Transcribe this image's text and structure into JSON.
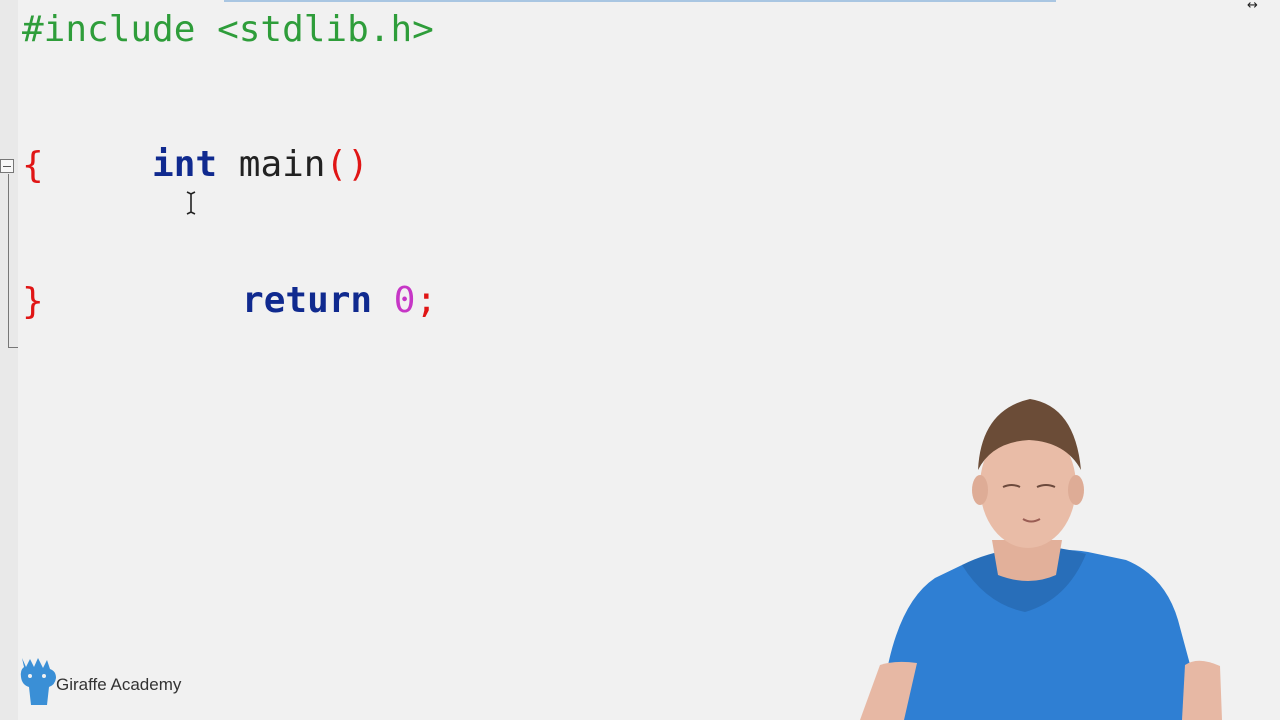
{
  "editor": {
    "lines": {
      "line1": "#include <stdlib.h>",
      "line3": {
        "keyword": "int",
        "name": "main",
        "parens": "()"
      },
      "line4": "{",
      "line6": {
        "keyword": "return",
        "value": "0",
        "semicolon": ";"
      },
      "line7": "}"
    }
  },
  "window": {
    "resize_glyph": "↔"
  },
  "brand": {
    "name": "Giraffe Academy",
    "icon": "giraffe-icon",
    "color": "#3a8fd6"
  },
  "colors": {
    "background": "#f1f1f1",
    "preprocessor": "#2e9d3a",
    "keyword": "#102a8f",
    "punctuation": "#e01515",
    "number": "#c636c6",
    "shirt": "#2f7fd3"
  }
}
